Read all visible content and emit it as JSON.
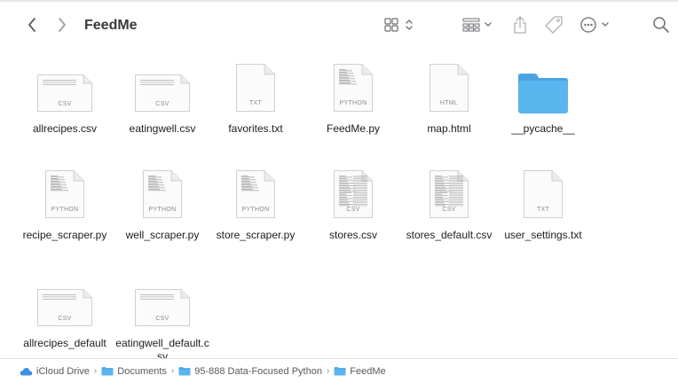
{
  "window": {
    "title": "FeedMe"
  },
  "toolbar": {
    "icons": [
      "chevron-left-icon",
      "chevron-right-icon",
      "icon-view-icon",
      "group-by-icon",
      "share-icon",
      "tag-icon",
      "more-icon",
      "search-icon"
    ]
  },
  "files": [
    {
      "name": "allrecipes.csv",
      "type": "csv",
      "tag": "CSV"
    },
    {
      "name": "eatingwell.csv",
      "type": "csv",
      "tag": "CSV"
    },
    {
      "name": "favorites.txt",
      "type": "txt",
      "tag": "TXT"
    },
    {
      "name": "FeedMe.py",
      "type": "python",
      "tag": "PYTHON"
    },
    {
      "name": "map.html",
      "type": "html",
      "tag": "HTML"
    },
    {
      "name": "__pycache__",
      "type": "folder",
      "tag": ""
    },
    {
      "name": "recipe_scraper.py",
      "type": "python",
      "tag": "PYTHON"
    },
    {
      "name": "well_scraper.py",
      "type": "python",
      "tag": "PYTHON"
    },
    {
      "name": "store_scraper.py",
      "type": "python",
      "tag": "PYTHON"
    },
    {
      "name": "stores.csv",
      "type": "csvdoc",
      "tag": "CSV"
    },
    {
      "name": "stores_default.csv",
      "type": "csvdoc",
      "tag": "CSV"
    },
    {
      "name": "user_settings.txt",
      "type": "txt",
      "tag": "TXT"
    },
    {
      "name": "allrecipes_default",
      "type": "csv",
      "tag": "CSV"
    },
    {
      "name": "eatingwell_default.csv",
      "type": "csv",
      "tag": "CSV"
    }
  ],
  "pathbar": [
    {
      "label": "iCloud Drive",
      "icon": "icloud-icon"
    },
    {
      "label": "Documents",
      "icon": "folder-icon"
    },
    {
      "label": "95-888 Data-Focused Python",
      "icon": "folder-icon"
    },
    {
      "label": "FeedMe",
      "icon": "folder-icon"
    }
  ],
  "colors": {
    "folder": "#5ab4ee",
    "folder_top": "#4aa3e0",
    "accent_cloud": "#3d8fe0"
  }
}
